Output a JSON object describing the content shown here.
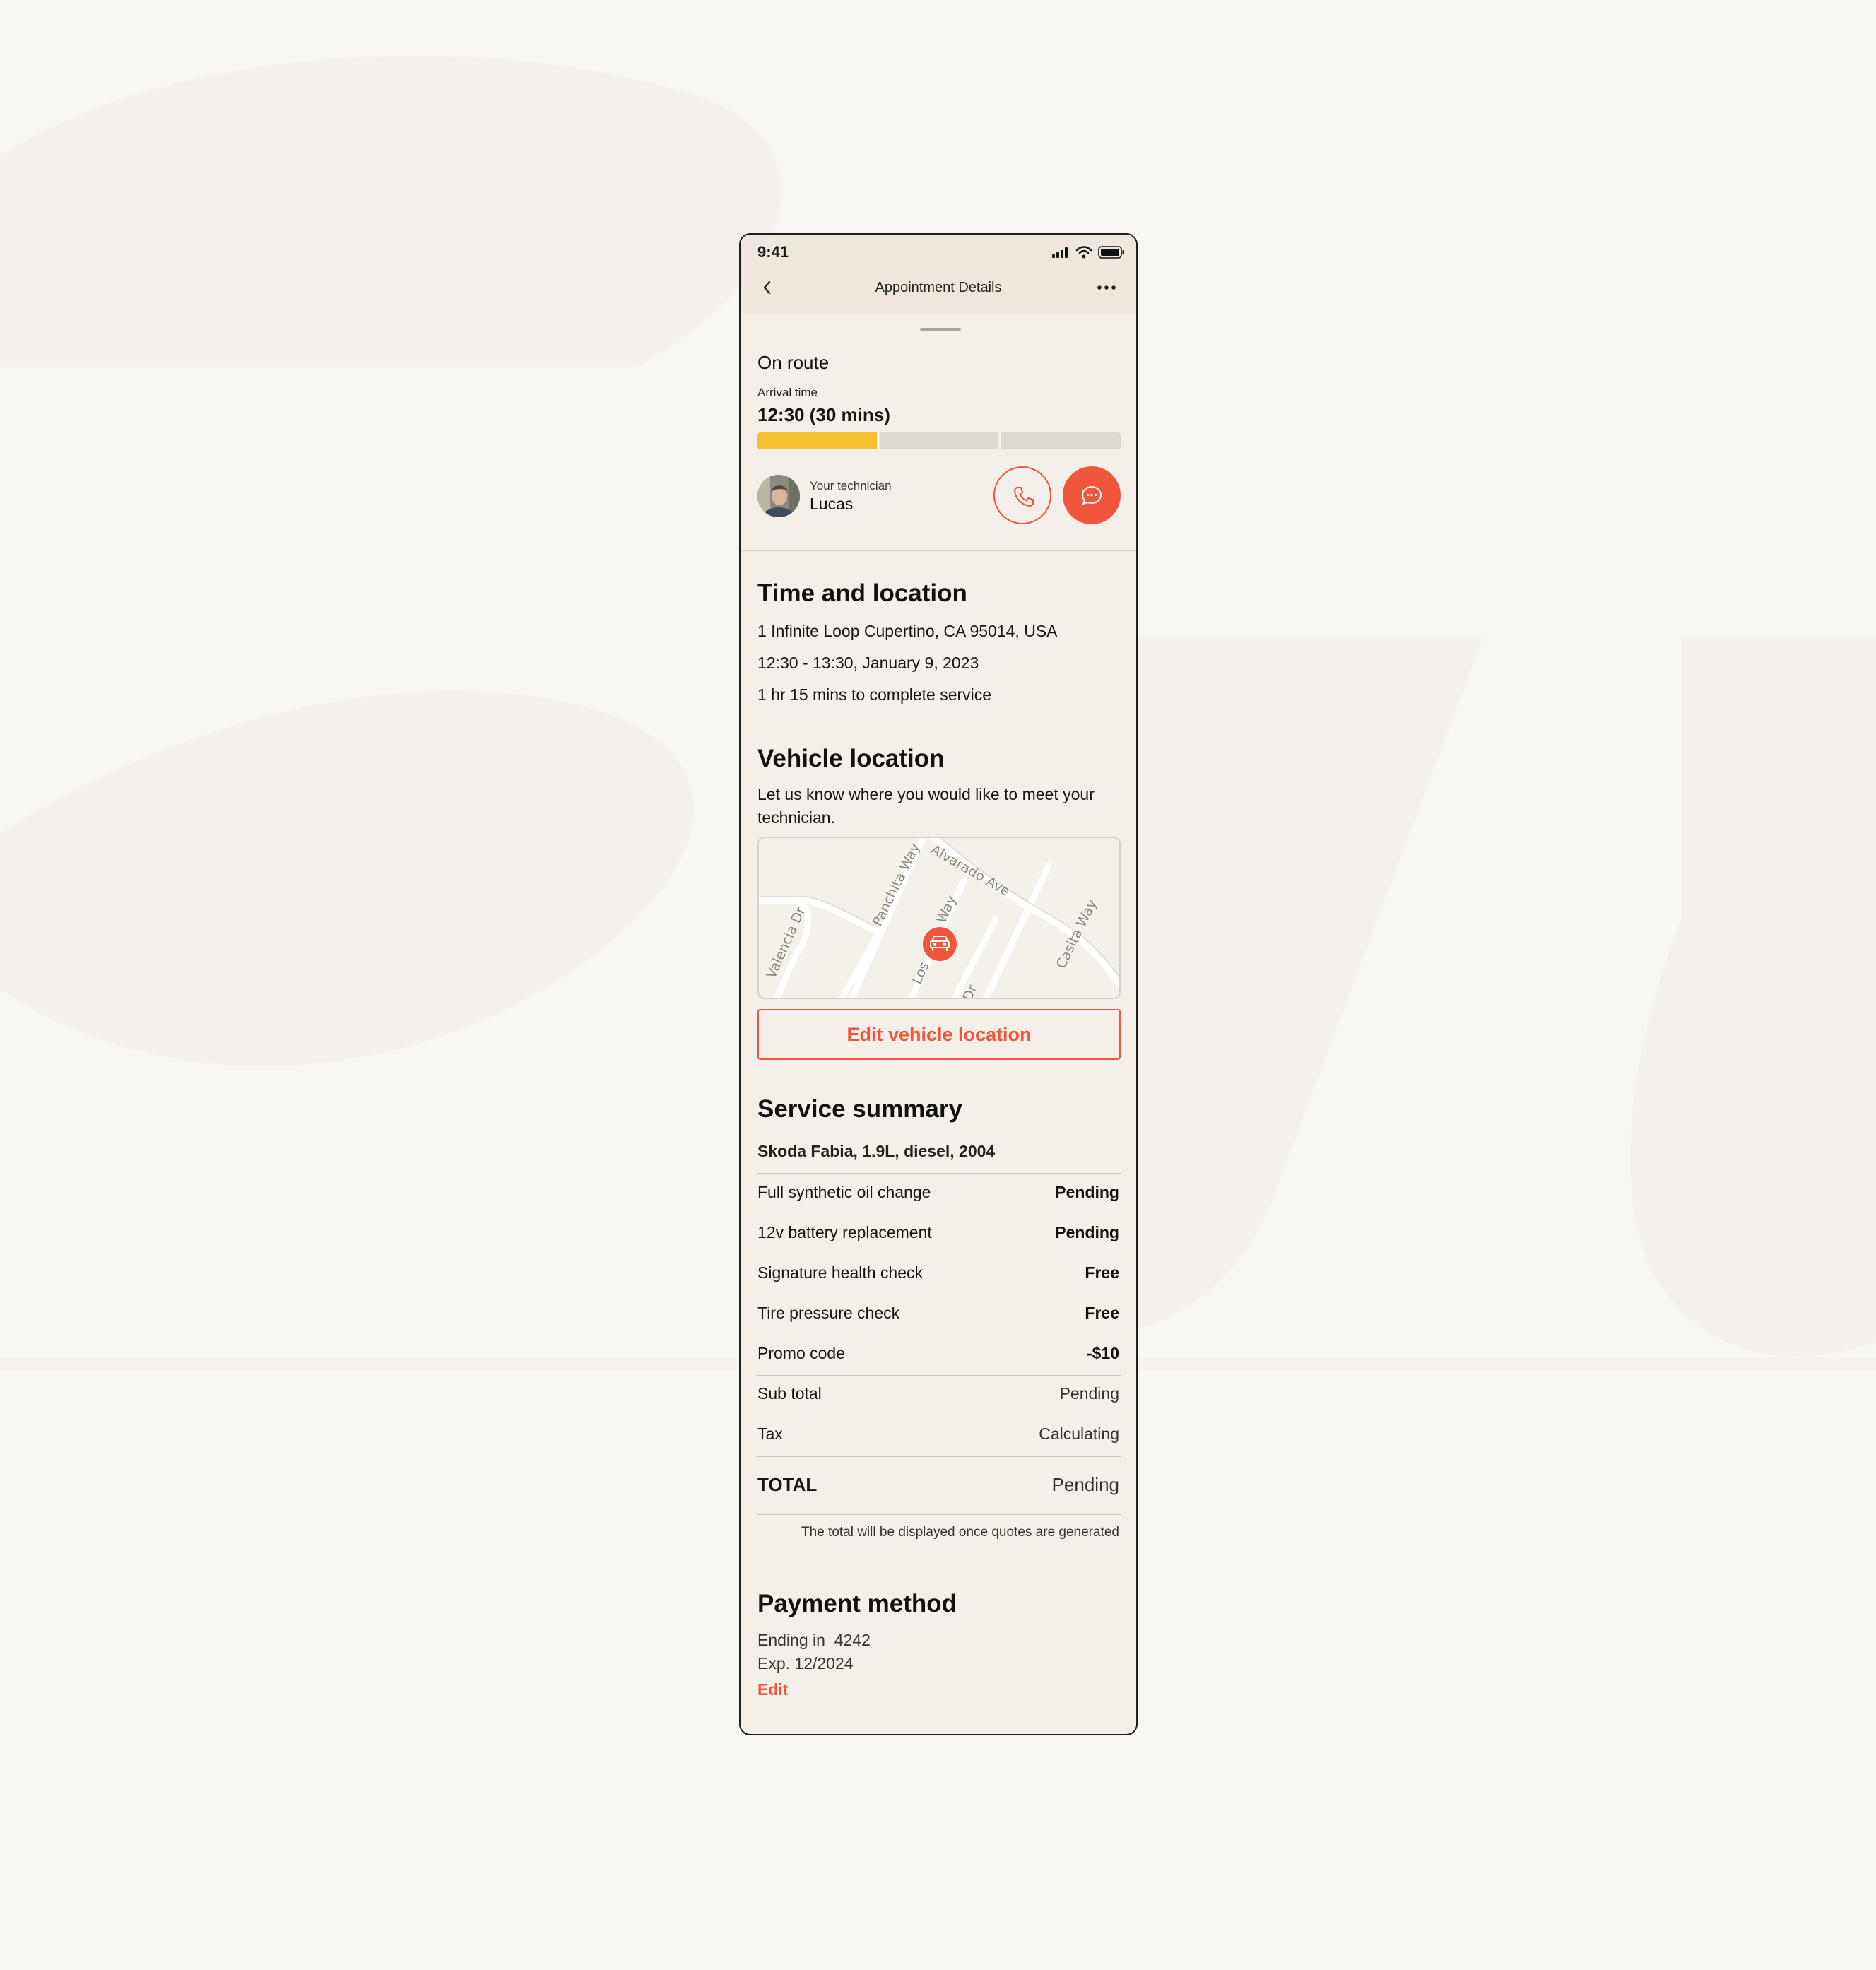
{
  "status_bar": {
    "time": "9:41"
  },
  "navbar": {
    "title": "Appointment Details"
  },
  "status": {
    "title": "On route",
    "arrival_label": "Arrival time",
    "arrival_value": "12:30 (30 mins)",
    "progress_fraction": 0.333
  },
  "technician": {
    "label": "Your technician",
    "name": "Lucas"
  },
  "time_location": {
    "heading": "Time and location",
    "address": "1 Infinite Loop Cupertino, CA 95014, USA",
    "time_range": "12:30 - 13:30, January 9, 2023",
    "duration": "1 hr 15 mins to complete service"
  },
  "vehicle_location": {
    "heading": "Vehicle location",
    "description": "Let us know where you would like to meet your technician.",
    "map_streets": [
      "Panchita Way",
      "Alvarado Ave",
      "Valencia Dr",
      "Los",
      "Way",
      "Casita Way",
      "Dr"
    ],
    "edit_button": "Edit vehicle location"
  },
  "service_summary": {
    "heading": "Service summary",
    "vehicle": "Skoda Fabia, 1.9L, diesel, 2004",
    "items": [
      {
        "label": "Full synthetic oil change",
        "value": "Pending"
      },
      {
        "label": "12v battery replacement",
        "value": "Pending"
      },
      {
        "label": "Signature health check",
        "value": "Free"
      },
      {
        "label": "Tire pressure check",
        "value": "Free"
      },
      {
        "label": "Promo code",
        "value": "-$10"
      }
    ],
    "subtotal": {
      "label": "Sub total",
      "value": "Pending"
    },
    "tax": {
      "label": "Tax",
      "value": "Calculating"
    },
    "total": {
      "label": "TOTAL",
      "value": "Pending"
    },
    "note": "The total will be displayed once quotes are generated"
  },
  "payment": {
    "heading": "Payment method",
    "card_ending": "Ending in  4242",
    "expiry": "Exp. 12/2024",
    "edit_label": "Edit"
  },
  "colors": {
    "accent": "#f0563b",
    "progress": "#f5bf32",
    "surface": "#f4f0e9",
    "page_background": "#f8f6f2"
  }
}
